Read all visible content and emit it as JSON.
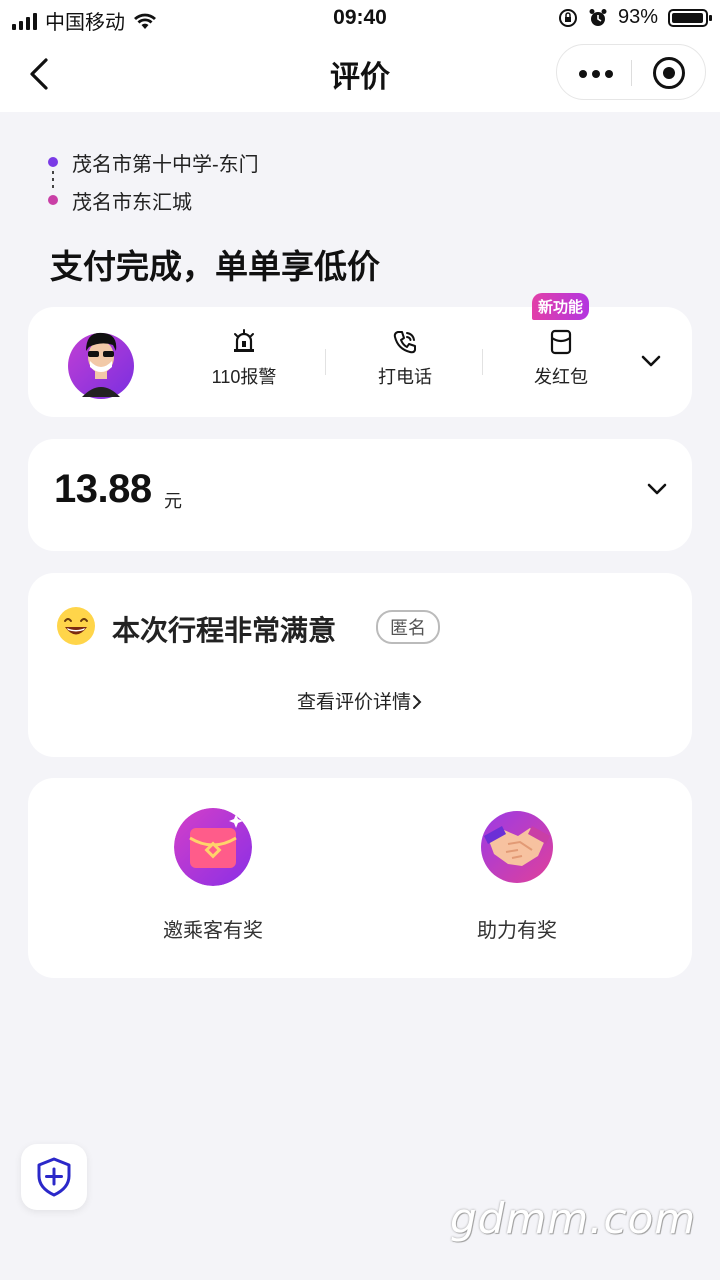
{
  "status_bar": {
    "carrier": "中国移动",
    "time": "09:40",
    "battery": "93%"
  },
  "nav": {
    "title": "评价"
  },
  "route": {
    "start": "茂名市第十中学-东门",
    "end": "茂名市东汇城"
  },
  "headline": "支付完成，单单享低价",
  "driver_actions": {
    "police": "110报警",
    "call": "打电话",
    "red_packet": "发红包",
    "new_badge": "新功能"
  },
  "fare": {
    "amount": "13.88",
    "unit": "元"
  },
  "rating": {
    "text": "本次行程非常满意",
    "anonymous": "匿名",
    "detail_link": "查看评价详情"
  },
  "promos": {
    "invite": "邀乘客有奖",
    "assist": "助力有奖"
  },
  "watermark": "gdmm.com",
  "colors": {
    "accent_purple": "#7a3ae6",
    "accent_magenta": "#c93fa6",
    "background": "#f4f4f8"
  }
}
